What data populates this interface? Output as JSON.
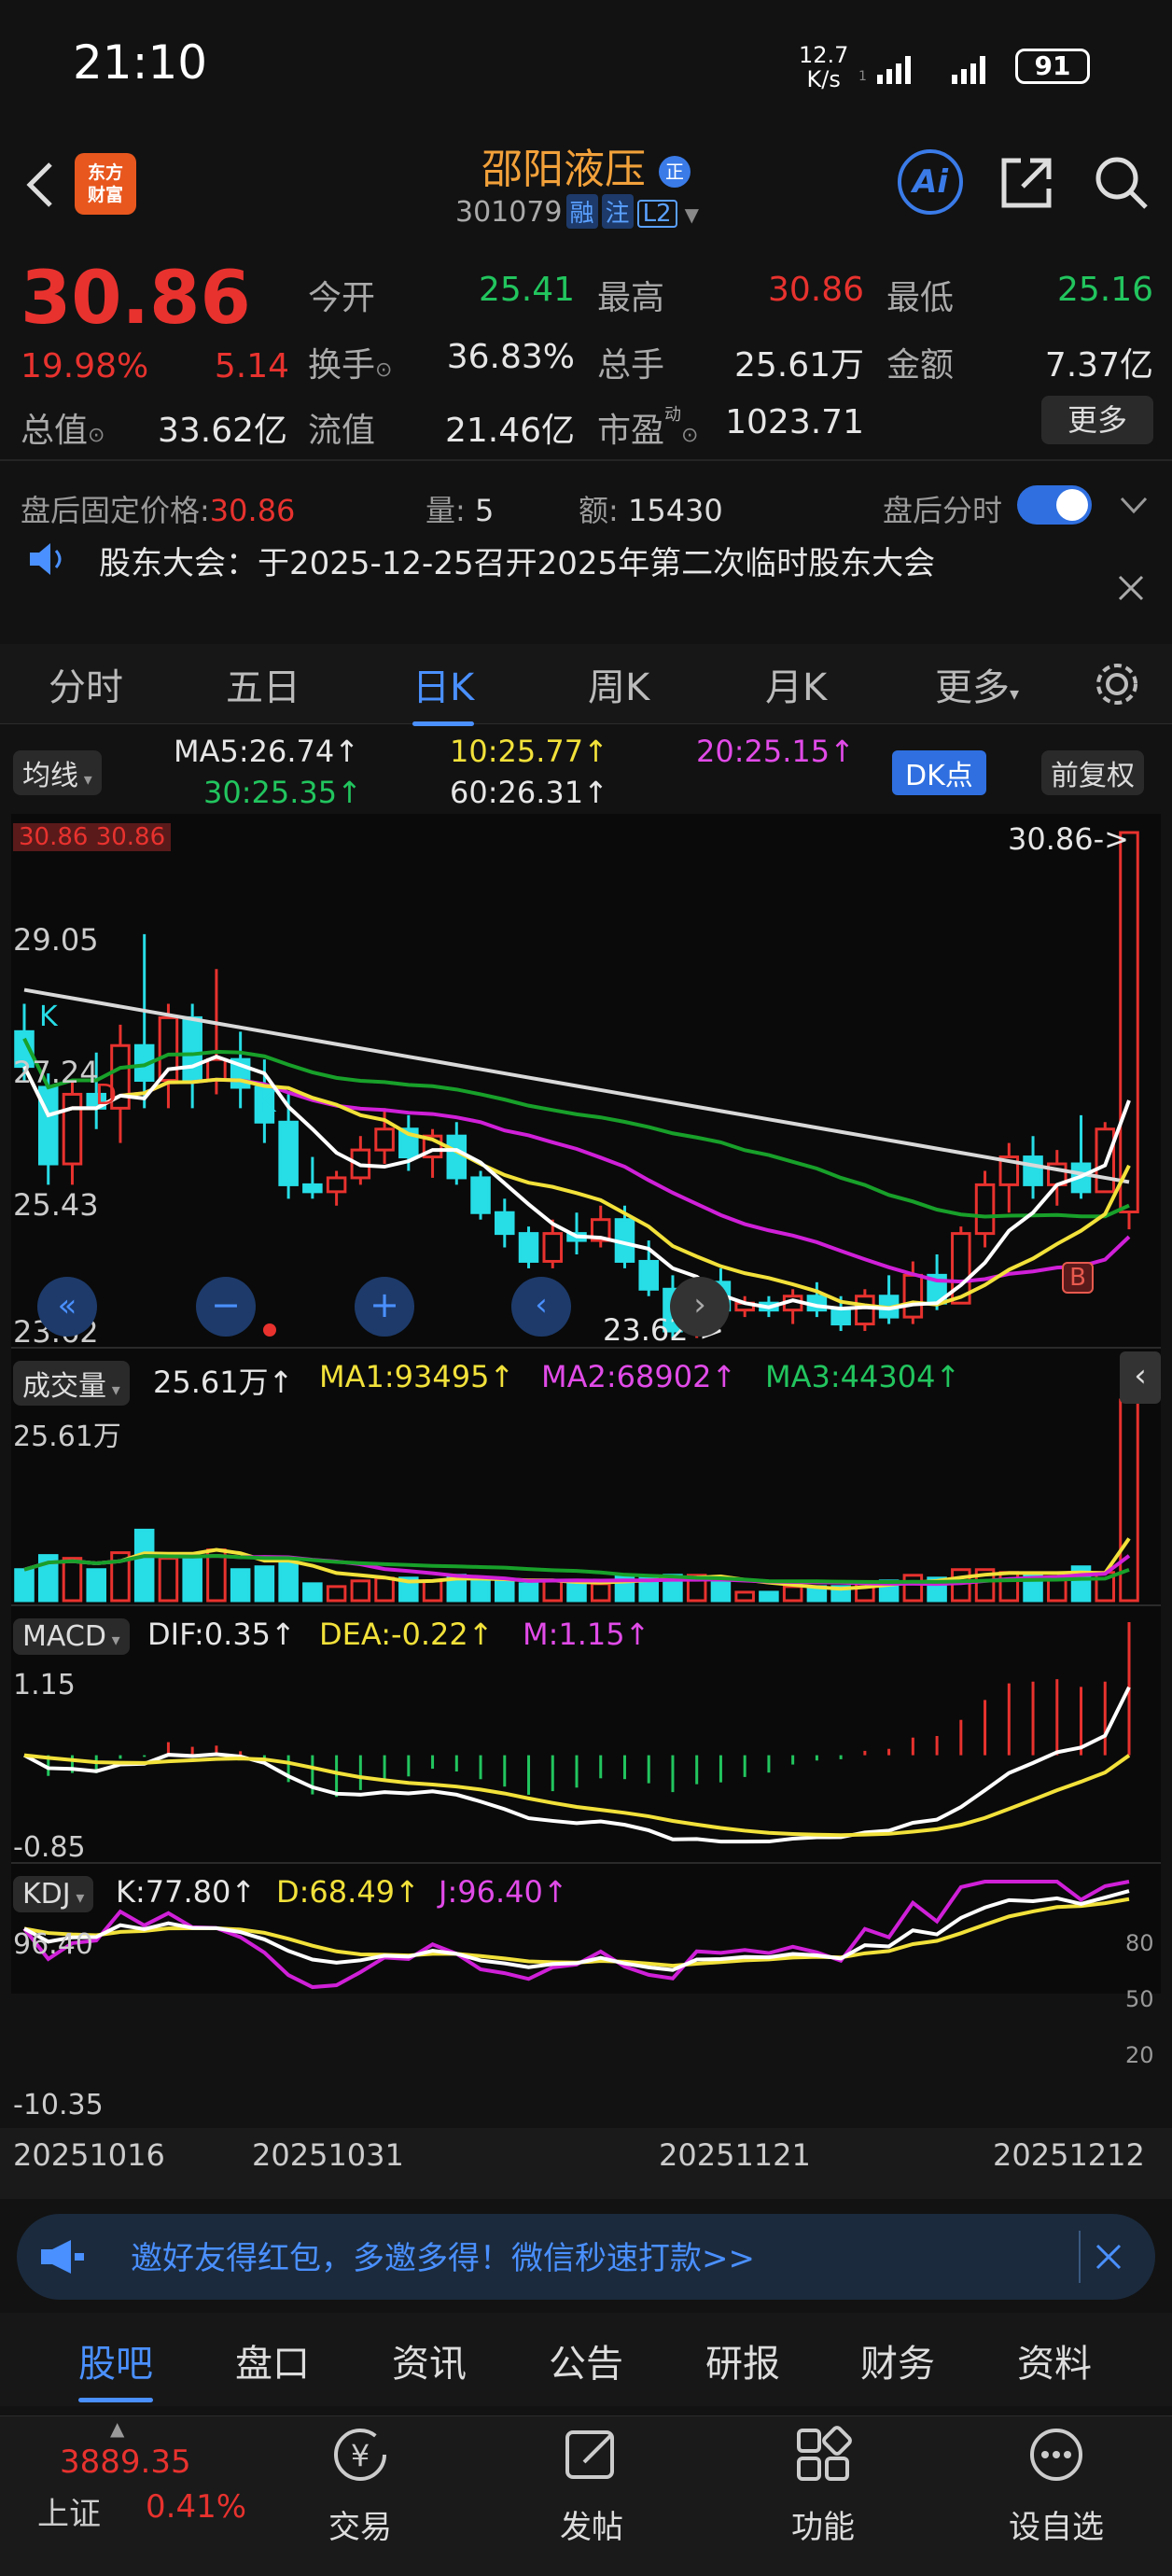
{
  "status_bar": {
    "time": "21:10",
    "net_speed_value": "12.7",
    "net_speed_unit": "K/s",
    "battery": "91"
  },
  "header": {
    "logo_line1": "东方",
    "logo_line2": "财富",
    "stock_name": "邵阳液压",
    "name_badge": "正",
    "stock_code": "301079",
    "tag_margin": "融",
    "tag_note": "注",
    "tag_level": "L2",
    "ai_label": "Ai"
  },
  "quote": {
    "price": "30.86",
    "change_pct": "19.98%",
    "change_amt": "5.14",
    "rows": [
      [
        {
          "label": "今开",
          "value": "25.41",
          "color": "green"
        },
        {
          "label": "最高",
          "value": "30.86",
          "color": "red"
        },
        {
          "label": "最低",
          "value": "25.16",
          "color": "green"
        }
      ],
      [
        {
          "label": "换手",
          "value": "36.83%",
          "color": "white"
        },
        {
          "label": "总手",
          "value": "25.61万",
          "color": "white"
        },
        {
          "label": "金额",
          "value": "7.37亿",
          "color": "white"
        }
      ],
      [
        {
          "label": "总值",
          "value": "33.62亿",
          "color": "white"
        },
        {
          "label": "流值",
          "value": "21.46亿",
          "color": "white"
        },
        {
          "label": "市盈",
          "value": "1023.71",
          "color": "white"
        }
      ]
    ],
    "more_button": "更多",
    "pe_superscript": "动"
  },
  "after_hours": {
    "fixed_price_label": "盘后固定价格:",
    "fixed_price": "30.86",
    "volume_label": "量:",
    "volume": "5",
    "amount_label": "额:",
    "amount": "15430",
    "timeshare_label": "盘后分时"
  },
  "notice": {
    "text": "股东大会：于2025-12-25召开2025年第二次临时股东大会"
  },
  "period_tabs": [
    "分时",
    "五日",
    "日K",
    "周K",
    "月K",
    "更多"
  ],
  "active_period": "日K",
  "chart_controls": {
    "ma_selector": "均线",
    "dk_button": "DK点",
    "adjust_button": "前复权"
  },
  "ma_legend": {
    "ma5": "MA5:26.74↑",
    "ma10": "10:25.77↑",
    "ma20": "20:25.15↑",
    "ma30": "30:25.35↑",
    "ma60": "60:26.31↑"
  },
  "price_axis": {
    "top_label": "30.86",
    "top_tag": "30.86",
    "labels": [
      "29.05",
      "27.24",
      "25.43",
      "23.62"
    ],
    "high_marker": "30.86->",
    "low_marker": "23.62->"
  },
  "volume_panel": {
    "selector": "成交量",
    "vol": "25.61万↑",
    "ma1": "MA1:93495↑",
    "ma2": "MA2:68902↑",
    "ma3": "MA3:44304↑",
    "axis_top": "25.61万"
  },
  "macd_panel": {
    "selector": "MACD",
    "dif": "DIF:0.35↑",
    "dea": "DEA:-0.22↑",
    "m": "M:1.15↑",
    "axis_top": "1.15",
    "axis_bottom": "-0.85"
  },
  "kdj_panel": {
    "selector": "KDJ",
    "k": "K:77.80↑",
    "d": "D:68.49↑",
    "j": "J:96.40↑",
    "axis_top": "96.40",
    "axis_bottom": "-10.35",
    "right_ticks": [
      "80",
      "50",
      "20"
    ]
  },
  "dates": [
    "20251016",
    "20251031",
    "20251121",
    "20251212"
  ],
  "chart_markers": {
    "k": "K",
    "d": "D",
    "b": "B"
  },
  "banner": {
    "text": "邀好友得红包，多邀多得！微信秒速打款>>"
  },
  "bottom_tabs": [
    "股吧",
    "盘口",
    "资讯",
    "公告",
    "研报",
    "财务",
    "资料"
  ],
  "active_bottom_tab": "股吧",
  "footer": {
    "index_value": "3889.35",
    "index_name": "上证",
    "index_change": "0.41%",
    "actions": [
      {
        "label": "交易",
        "icon": "yen-circle-icon"
      },
      {
        "label": "发帖",
        "icon": "edit-icon"
      },
      {
        "label": "功能",
        "icon": "grid-icon"
      },
      {
        "label": "设自选",
        "icon": "more-circle-icon"
      }
    ]
  },
  "chart_data": {
    "type": "candlestick",
    "x": [
      "20251016",
      "",
      "",
      "",
      "",
      "",
      "",
      "",
      "",
      "",
      "",
      "20251031",
      "",
      "",
      "",
      "",
      "",
      "",
      "",
      "",
      "",
      "",
      "",
      "",
      "",
      "",
      "",
      "20251121",
      "",
      "",
      "",
      "",
      "",
      "",
      "",
      "",
      "",
      "",
      "",
      "",
      "",
      "",
      "",
      "",
      "",
      "",
      "20251212"
    ],
    "ohlc": [
      [
        28.0,
        28.4,
        27.3,
        27.5
      ],
      [
        27.2,
        27.4,
        25.8,
        26.1
      ],
      [
        26.1,
        27.3,
        25.8,
        27.1
      ],
      [
        27.1,
        27.7,
        26.6,
        26.9
      ],
      [
        26.9,
        28.1,
        26.4,
        27.8
      ],
      [
        27.8,
        29.4,
        26.9,
        27.3
      ],
      [
        27.3,
        28.4,
        26.9,
        28.2
      ],
      [
        28.2,
        28.4,
        26.9,
        27.3
      ],
      [
        27.3,
        28.9,
        27.1,
        27.6
      ],
      [
        27.6,
        28.0,
        26.9,
        27.2
      ],
      [
        27.2,
        27.6,
        26.4,
        26.7
      ],
      [
        26.7,
        27.1,
        25.6,
        25.8
      ],
      [
        25.8,
        26.2,
        25.6,
        25.7
      ],
      [
        25.7,
        26.0,
        25.5,
        25.9
      ],
      [
        25.9,
        26.5,
        25.8,
        26.3
      ],
      [
        26.3,
        26.9,
        26.1,
        26.6
      ],
      [
        26.6,
        26.8,
        26.0,
        26.2
      ],
      [
        26.2,
        26.6,
        25.9,
        26.5
      ],
      [
        26.5,
        26.7,
        25.8,
        25.9
      ],
      [
        25.9,
        26.0,
        25.3,
        25.4
      ],
      [
        25.4,
        25.6,
        24.9,
        25.1
      ],
      [
        25.1,
        25.2,
        24.6,
        24.7
      ],
      [
        24.7,
        25.3,
        24.6,
        25.1
      ],
      [
        25.1,
        25.4,
        24.8,
        25.0
      ],
      [
        25.0,
        25.5,
        24.9,
        25.3
      ],
      [
        25.3,
        25.5,
        24.6,
        24.7
      ],
      [
        24.7,
        25.0,
        24.2,
        24.3
      ],
      [
        24.3,
        24.5,
        23.6,
        23.7
      ],
      [
        23.7,
        24.5,
        23.6,
        24.4
      ],
      [
        24.4,
        24.6,
        23.8,
        24.0
      ],
      [
        24.0,
        24.2,
        23.9,
        24.1
      ],
      [
        24.1,
        24.2,
        23.9,
        24.0
      ],
      [
        24.0,
        24.3,
        23.8,
        24.2
      ],
      [
        24.2,
        24.4,
        23.9,
        24.0
      ],
      [
        24.0,
        24.2,
        23.7,
        23.8
      ],
      [
        23.8,
        24.3,
        23.7,
        24.2
      ],
      [
        24.2,
        24.5,
        23.8,
        23.9
      ],
      [
        23.9,
        24.7,
        23.8,
        24.5
      ],
      [
        24.5,
        24.8,
        24.0,
        24.1
      ],
      [
        24.1,
        25.2,
        24.1,
        25.1
      ],
      [
        25.1,
        26.0,
        24.9,
        25.8
      ],
      [
        25.8,
        26.4,
        25.4,
        26.2
      ],
      [
        26.2,
        26.5,
        25.6,
        25.8
      ],
      [
        25.8,
        26.3,
        25.5,
        26.1
      ],
      [
        26.1,
        26.8,
        25.6,
        25.7
      ],
      [
        25.7,
        26.7,
        25.7,
        26.6
      ],
      [
        25.41,
        30.86,
        25.16,
        30.86
      ]
    ],
    "ylim": [
      23.62,
      30.86
    ]
  }
}
